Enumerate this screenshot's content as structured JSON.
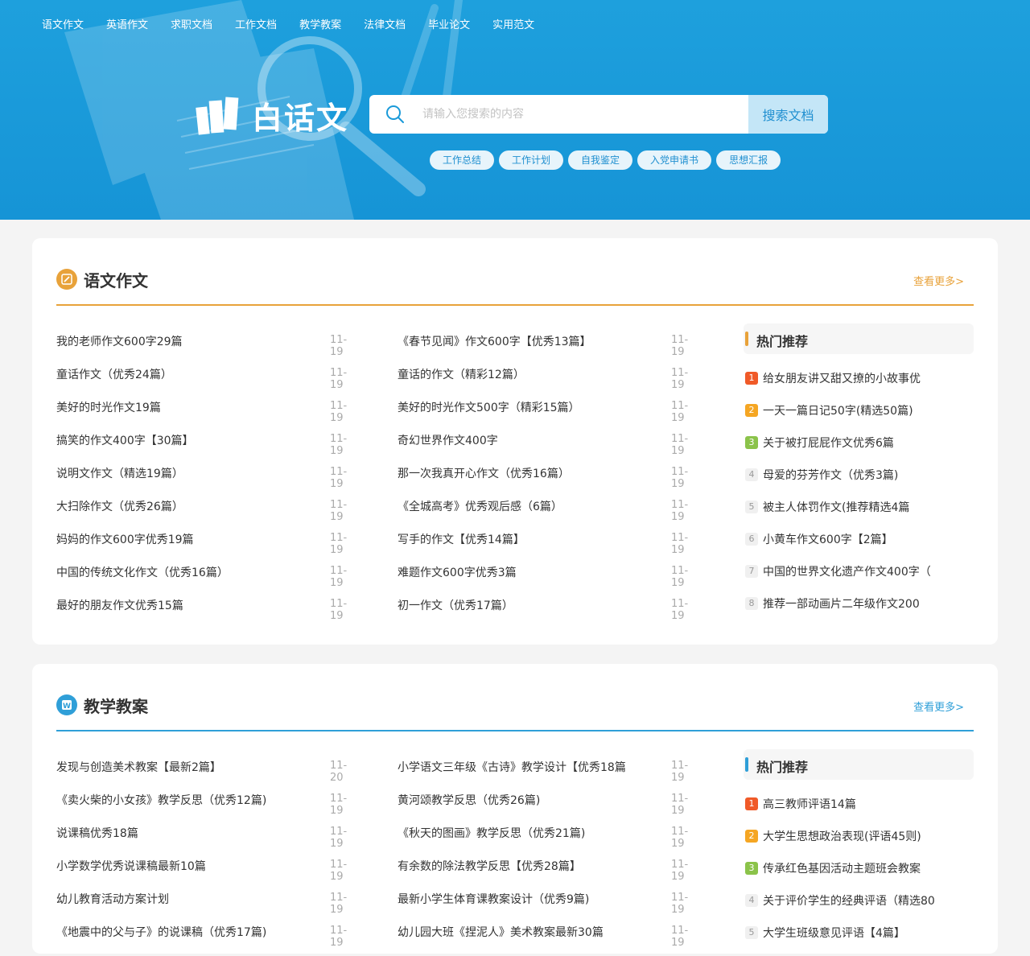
{
  "nav": [
    "语文作文",
    "英语作文",
    "求职文档",
    "工作文档",
    "教学教案",
    "法律文档",
    "毕业论文",
    "实用范文"
  ],
  "brand": {
    "name": "白话文"
  },
  "search": {
    "placeholder": "请输入您搜索的内容",
    "button": "搜索文档",
    "icon": "search-icon"
  },
  "hot_tags": [
    "工作总结",
    "工作计划",
    "自我鉴定",
    "入党申请书",
    "思想汇报"
  ],
  "colors": {
    "hero": "#1a9ad9",
    "orange": "#e8a23a",
    "blue": "#2f9fd8",
    "rank1": "#f05a28",
    "rank2": "#f5a623",
    "rank3": "#8bc34a"
  },
  "sections": [
    {
      "title": "语文作文",
      "more": "查看更多>",
      "icon": "pencil-icon",
      "left": [
        {
          "title": "我的老师作文600字29篇",
          "date": "11-19"
        },
        {
          "title": "童话作文（优秀24篇）",
          "date": "11-19"
        },
        {
          "title": "美好的时光作文19篇",
          "date": "11-19"
        },
        {
          "title": "搞笑的作文400字【30篇】",
          "date": "11-19"
        },
        {
          "title": "说明文作文（精选19篇）",
          "date": "11-19"
        },
        {
          "title": "大扫除作文（优秀26篇）",
          "date": "11-19"
        },
        {
          "title": "妈妈的作文600字优秀19篇",
          "date": "11-19"
        },
        {
          "title": "中国的传统文化作文（优秀16篇）",
          "date": "11-19"
        },
        {
          "title": "最好的朋友作文优秀15篇",
          "date": "11-19"
        }
      ],
      "right": [
        {
          "title": "《春节见闻》作文600字【优秀13篇】",
          "date": "11-19"
        },
        {
          "title": "童话的作文（精彩12篇）",
          "date": "11-19"
        },
        {
          "title": "美好的时光作文500字（精彩15篇）",
          "date": "11-19"
        },
        {
          "title": "奇幻世界作文400字",
          "date": "11-19"
        },
        {
          "title": "那一次我真开心作文（优秀16篇）",
          "date": "11-19"
        },
        {
          "title": "《全城高考》优秀观后感（6篇）",
          "date": "11-19"
        },
        {
          "title": "写手的作文【优秀14篇】",
          "date": "11-19"
        },
        {
          "title": "难题作文600字优秀3篇",
          "date": "11-19"
        },
        {
          "title": "初一作文（优秀17篇）",
          "date": "11-19"
        }
      ],
      "hot_title": "热门推荐",
      "hot": [
        {
          "rank": "1",
          "title": "给女朋友讲又甜又撩的小故事优"
        },
        {
          "rank": "2",
          "title": "一天一篇日记50字(精选50篇)"
        },
        {
          "rank": "3",
          "title": "关于被打屁屁作文优秀6篇"
        },
        {
          "rank": "4",
          "title": "母爱的芬芳作文（优秀3篇)"
        },
        {
          "rank": "5",
          "title": "被主人体罚作文(推荐精选4篇"
        },
        {
          "rank": "6",
          "title": "小黄车作文600字【2篇】"
        },
        {
          "rank": "7",
          "title": "中国的世界文化遗产作文400字（"
        },
        {
          "rank": "8",
          "title": "推荐一部动画片二年级作文200"
        }
      ]
    },
    {
      "title": "教学教案",
      "more": "查看更多>",
      "icon": "word-doc-icon",
      "left": [
        {
          "title": "发现与创造美术教案【最新2篇】",
          "date": "11-20"
        },
        {
          "title": "《卖火柴的小女孩》教学反思（优秀12篇)",
          "date": "11-19"
        },
        {
          "title": "说课稿优秀18篇",
          "date": "11-19"
        },
        {
          "title": "小学数学优秀说课稿最新10篇",
          "date": "11-19"
        },
        {
          "title": "幼儿教育活动方案计划",
          "date": "11-19"
        },
        {
          "title": "《地震中的父与子》的说课稿（优秀17篇)",
          "date": "11-19"
        }
      ],
      "right": [
        {
          "title": "小学语文三年级《古诗》教学设计【优秀18篇",
          "date": "11-19"
        },
        {
          "title": "黄河颂教学反思（优秀26篇)",
          "date": "11-19"
        },
        {
          "title": "《秋天的图画》教学反思（优秀21篇)",
          "date": "11-19"
        },
        {
          "title": "有余数的除法教学反思【优秀28篇】",
          "date": "11-19"
        },
        {
          "title": "最新小学生体育课教案设计（优秀9篇)",
          "date": "11-19"
        },
        {
          "title": "幼儿园大班《捏泥人》美术教案最新30篇",
          "date": "11-19"
        }
      ],
      "hot_title": "热门推荐",
      "hot": [
        {
          "rank": "1",
          "title": "高三教师评语14篇"
        },
        {
          "rank": "2",
          "title": "大学生思想政治表现(评语45则)"
        },
        {
          "rank": "3",
          "title": "传承红色基因活动主题班会教案"
        },
        {
          "rank": "4",
          "title": "关于评价学生的经典评语（精选80"
        },
        {
          "rank": "5",
          "title": "大学生班级意见评语【4篇】"
        }
      ]
    }
  ]
}
